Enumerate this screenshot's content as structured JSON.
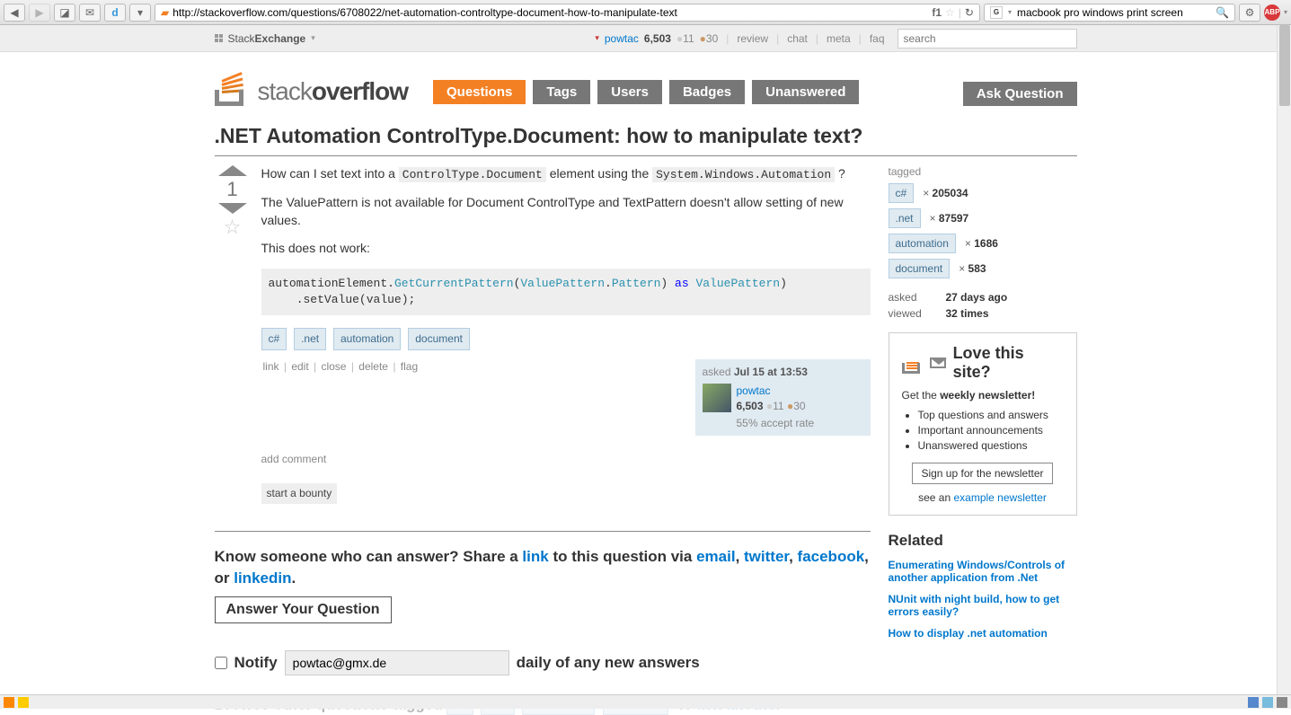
{
  "browser": {
    "url": "http://stackoverflow.com/questions/6708022/net-automation-controltype-document-how-to-manipulate-text",
    "searchPlaceholder": "macbook pro windows print screen",
    "f1": "f1"
  },
  "topbar": {
    "brand_a": "Stack",
    "brand_b": "Exchange",
    "user": "powtac",
    "rep": "6,503",
    "silver": "11",
    "bronze": "30",
    "links": {
      "review": "review",
      "chat": "chat",
      "meta": "meta",
      "faq": "faq"
    },
    "searchPlaceholder": "search"
  },
  "logo": {
    "a": "stack",
    "b": "overflow"
  },
  "nav": {
    "questions": "Questions",
    "tags": "Tags",
    "users": "Users",
    "badges": "Badges",
    "unanswered": "Unanswered",
    "ask": "Ask Question"
  },
  "title": ".NET Automation ControlType.Document: how to manipulate text?",
  "question": {
    "score": "1",
    "body": {
      "p1_a": "How can I set text into a ",
      "p1_code1": "ControlType.Document",
      "p1_b": " element using the ",
      "p1_code2": "System.Windows.Automation",
      "p1_c": " ?",
      "p2": "The ValuePattern is not available for Document ControlType and TextPattern doesn't allow setting of new values.",
      "p3": "This does not work:",
      "code": "automationElement.GetCurrentPattern(ValuePattern.Pattern) as ValuePattern)\n    .setValue(value);"
    },
    "tags": [
      "c#",
      ".net",
      "automation",
      "document"
    ],
    "menu": {
      "link": "link",
      "edit": "edit",
      "close": "close",
      "delete": "delete",
      "flag": "flag"
    },
    "sig": {
      "asked_a": "asked ",
      "asked_b": "Jul 15 at 13:53",
      "user": "powtac",
      "rep": "6,503",
      "silver": "11",
      "bronze": "30",
      "accept": "55% accept rate"
    },
    "addcomment": "add comment",
    "bounty": "start a bounty"
  },
  "share": {
    "a": "Know someone who can answer? Share a ",
    "link": "link",
    "b": " to this question via ",
    "email": "email",
    "c": ", ",
    "twitter": "twitter",
    "d": ", ",
    "facebook": "facebook",
    "e": ", or ",
    "linkedin": "linkedin",
    "f": ".",
    "answerbtn": "Answer Your Question"
  },
  "notify": {
    "label": "Notify",
    "email": "powtac@gmx.de",
    "suffix": "daily of any new answers"
  },
  "browse": {
    "a": "Browse other questions tagged ",
    "b": " or ",
    "ask": "ask another"
  },
  "sidebar": {
    "tagged": "tagged",
    "tagrows": [
      {
        "tag": "c#",
        "count": "205034"
      },
      {
        "tag": ".net",
        "count": "87597"
      },
      {
        "tag": "automation",
        "count": "1686"
      },
      {
        "tag": "document",
        "count": "583"
      }
    ],
    "askedlbl": "asked",
    "askedval": "27 days ago",
    "viewedlbl": "viewed",
    "viewedval": "32 times",
    "news": {
      "title": "Love this site?",
      "lead_a": "Get the ",
      "lead_b": "weekly newsletter!",
      "items": [
        "Top questions and answers",
        "Important announcements",
        "Unanswered questions"
      ],
      "signup": "Sign up for the newsletter",
      "example_a": "see an ",
      "example_b": "example newsletter"
    },
    "related_h": "Related",
    "related": [
      "Enumerating Windows/Controls of another application from .Net",
      "NUnit with night build, how to get errors easily?",
      "How to display .net automation"
    ]
  }
}
